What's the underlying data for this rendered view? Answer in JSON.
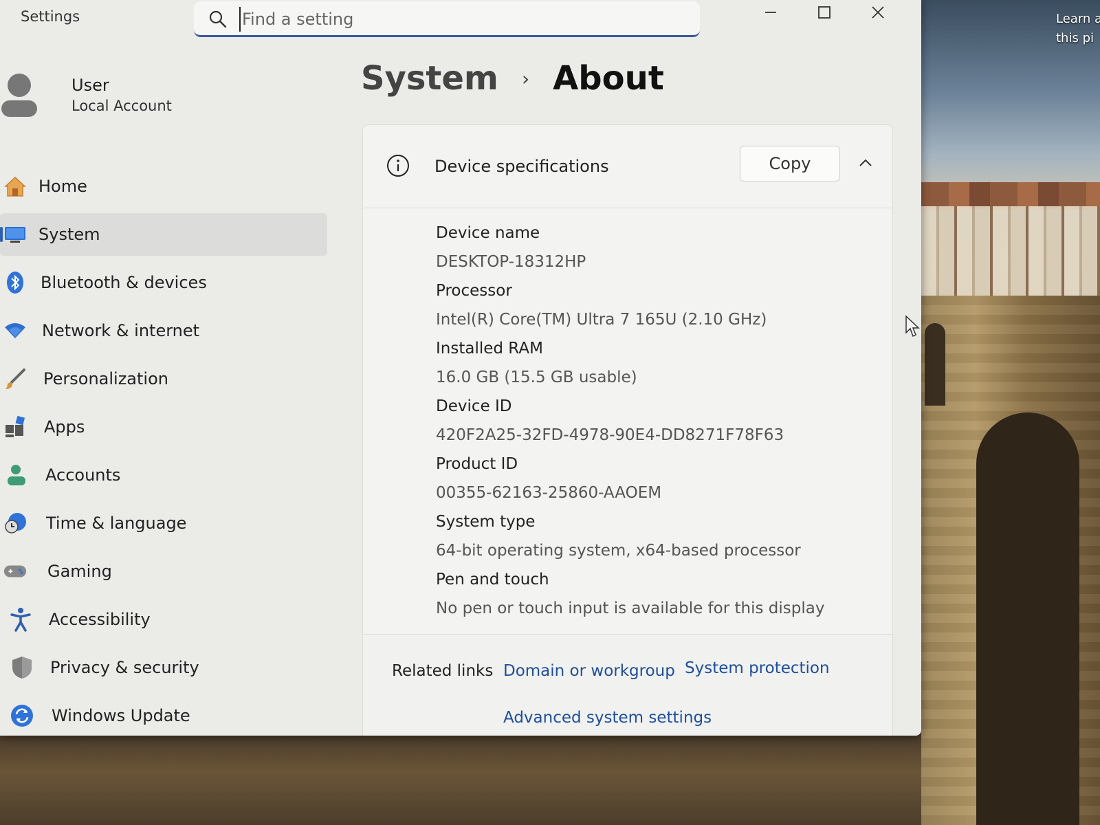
{
  "window": {
    "title": "Settings",
    "search_placeholder": "Find a setting"
  },
  "user": {
    "name": "User",
    "account_type": "Local Account"
  },
  "nav": {
    "items": [
      {
        "label": "Home"
      },
      {
        "label": "System"
      },
      {
        "label": "Bluetooth & devices"
      },
      {
        "label": "Network & internet"
      },
      {
        "label": "Personalization"
      },
      {
        "label": "Apps"
      },
      {
        "label": "Accounts"
      },
      {
        "label": "Time & language"
      },
      {
        "label": "Gaming"
      },
      {
        "label": "Accessibility"
      },
      {
        "label": "Privacy & security"
      },
      {
        "label": "Windows Update"
      }
    ],
    "active": "System"
  },
  "breadcrumb": {
    "parent": "System",
    "separator": "›",
    "current": "About"
  },
  "specs": {
    "title": "Device specifications",
    "copy_label": "Copy",
    "rows": [
      {
        "label": "Device name",
        "value": "DESKTOP-18312HP"
      },
      {
        "label": "Processor",
        "value": "Intel(R) Core(TM) Ultra 7 165U (2.10 GHz)"
      },
      {
        "label": "Installed RAM",
        "value": "16.0 GB (15.5 GB usable)"
      },
      {
        "label": "Device ID",
        "value": "420F2A25-32FD-4978-90E4-DD8271F78F63"
      },
      {
        "label": "Product ID",
        "value": "00355-62163-25860-AAOEM"
      },
      {
        "label": "System type",
        "value": "64-bit operating system, x64-based processor"
      },
      {
        "label": "Pen and touch",
        "value": "No pen or touch input is available for this display"
      }
    ]
  },
  "related": {
    "label": "Related links",
    "links": [
      "Domain or workgroup",
      "System protection",
      "Advanced system settings"
    ]
  },
  "desktop": {
    "learn_line1": "Learn a",
    "learn_line2": "this pi"
  },
  "colors": {
    "accent": "#2c5fb5",
    "link": "#1d4f9c",
    "window_bg": "#ebebe8"
  }
}
